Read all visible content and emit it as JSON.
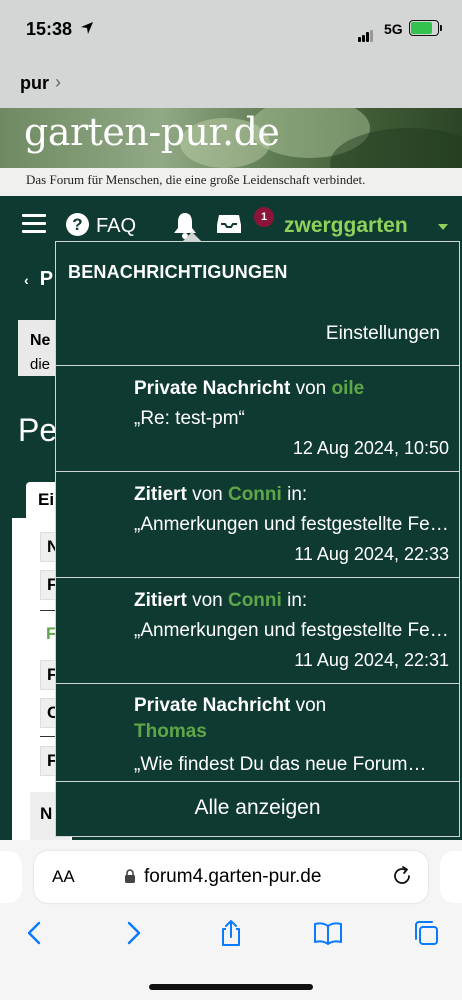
{
  "status": {
    "time": "15:38",
    "network": "5G"
  },
  "back": {
    "label": "pur"
  },
  "site": {
    "title": "garten-pur.de",
    "tagline": "Das Forum für Menschen, die eine große Leidenschaft verbindet."
  },
  "nav": {
    "faq_label": "FAQ",
    "notification_count": "1",
    "username": "zwerggarten"
  },
  "background_page": {
    "back_label": "P",
    "notice_title": "Ne",
    "notice_text": "die",
    "page_title": "Pe",
    "tab_label": "Ei",
    "rows": [
      "N",
      "F",
      "F",
      "F",
      "C",
      "F"
    ],
    "block_label": "N"
  },
  "notifications": {
    "header": "BENACHRICHTIGUNGEN",
    "settings_label": "Einstellungen",
    "items": [
      {
        "action": "Private Nachricht",
        "by": "von",
        "user": "oile",
        "suffix": "",
        "preview": "„Re: test-pm“",
        "time": "12 Aug 2024, 10:50"
      },
      {
        "action": "Zitiert",
        "by": "von",
        "user": "Conni",
        "suffix": "in:",
        "preview": "„Anmerkungen und festgestellte Fehler…",
        "time": "11 Aug 2024, 22:33"
      },
      {
        "action": "Zitiert",
        "by": "von",
        "user": "Conni",
        "suffix": "in:",
        "preview": "„Anmerkungen und festgestellte Fehler…",
        "time": "11 Aug 2024, 22:31"
      },
      {
        "action": "Private Nachricht",
        "by": "von",
        "user": "Thomas",
        "suffix": "",
        "preview": "„Wie findest Du das neue Forum…",
        "time": ""
      }
    ],
    "show_all_label": "Alle anzeigen"
  },
  "browser": {
    "text_size_label": "AA",
    "url": "forum4.garten-pur.de"
  },
  "colors": {
    "forum_green": "#0f3a31",
    "username_green": "#8fd15a",
    "link_green": "#5fa64a",
    "badge_red": "#8b1538",
    "ios_blue": "#0a7aff"
  }
}
